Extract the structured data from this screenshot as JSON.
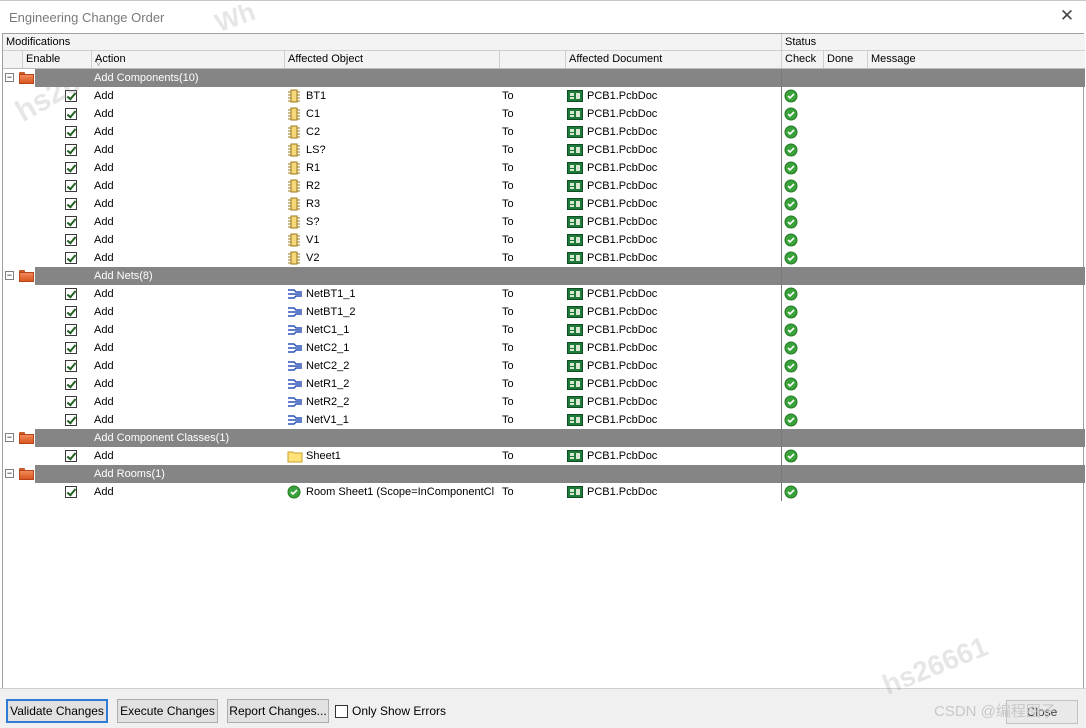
{
  "window": {
    "title": "Engineering Change Order",
    "close_glyph": "✕"
  },
  "headers": {
    "modifications": "Modifications",
    "status": "Status",
    "enable": "Enable",
    "action": "Action",
    "affected_object": "Affected Object",
    "affected_document": "Affected Document",
    "check": "Check",
    "done": "Done",
    "message": "Message"
  },
  "groups": [
    {
      "name": "Add Components(10)",
      "object_icon": "component-icon",
      "rows": [
        {
          "action": "Add",
          "object": "BT1",
          "to": "To",
          "document": "PCB1.PcbDoc"
        },
        {
          "action": "Add",
          "object": "C1",
          "to": "To",
          "document": "PCB1.PcbDoc"
        },
        {
          "action": "Add",
          "object": "C2",
          "to": "To",
          "document": "PCB1.PcbDoc"
        },
        {
          "action": "Add",
          "object": "LS?",
          "to": "To",
          "document": "PCB1.PcbDoc"
        },
        {
          "action": "Add",
          "object": "R1",
          "to": "To",
          "document": "PCB1.PcbDoc"
        },
        {
          "action": "Add",
          "object": "R2",
          "to": "To",
          "document": "PCB1.PcbDoc"
        },
        {
          "action": "Add",
          "object": "R3",
          "to": "To",
          "document": "PCB1.PcbDoc"
        },
        {
          "action": "Add",
          "object": "S?",
          "to": "To",
          "document": "PCB1.PcbDoc"
        },
        {
          "action": "Add",
          "object": "V1",
          "to": "To",
          "document": "PCB1.PcbDoc"
        },
        {
          "action": "Add",
          "object": "V2",
          "to": "To",
          "document": "PCB1.PcbDoc"
        }
      ]
    },
    {
      "name": "Add Nets(8)",
      "object_icon": "net-icon",
      "rows": [
        {
          "action": "Add",
          "object": "NetBT1_1",
          "to": "To",
          "document": "PCB1.PcbDoc"
        },
        {
          "action": "Add",
          "object": "NetBT1_2",
          "to": "To",
          "document": "PCB1.PcbDoc"
        },
        {
          "action": "Add",
          "object": "NetC1_1",
          "to": "To",
          "document": "PCB1.PcbDoc"
        },
        {
          "action": "Add",
          "object": "NetC2_1",
          "to": "To",
          "document": "PCB1.PcbDoc"
        },
        {
          "action": "Add",
          "object": "NetC2_2",
          "to": "To",
          "document": "PCB1.PcbDoc"
        },
        {
          "action": "Add",
          "object": "NetR1_2",
          "to": "To",
          "document": "PCB1.PcbDoc"
        },
        {
          "action": "Add",
          "object": "NetR2_2",
          "to": "To",
          "document": "PCB1.PcbDoc"
        },
        {
          "action": "Add",
          "object": "NetV1_1",
          "to": "To",
          "document": "PCB1.PcbDoc"
        }
      ]
    },
    {
      "name": "Add Component Classes(1)",
      "object_icon": "folder-icon",
      "rows": [
        {
          "action": "Add",
          "object": "Sheet1",
          "to": "To",
          "document": "PCB1.PcbDoc"
        }
      ]
    },
    {
      "name": "Add Rooms(1)",
      "object_icon": "room-check-icon",
      "rows": [
        {
          "action": "Add",
          "object": "Room Sheet1 (Scope=InComponentCl",
          "to": "To",
          "document": "PCB1.PcbDoc"
        }
      ]
    }
  ],
  "buttons": {
    "validate": "Validate Changes",
    "execute": "Execute Changes",
    "report": "Report Changes...",
    "only_show_errors": "Only Show Errors",
    "close": "Close"
  },
  "watermarks": {
    "top": "Wh",
    "left": "hs26",
    "right": "hs26661",
    "credit": "CSDN @编程图子"
  },
  "colors": {
    "group_row": "#858585",
    "check_green": "#3aa23a",
    "default_button_border": "#2f7bd6"
  }
}
